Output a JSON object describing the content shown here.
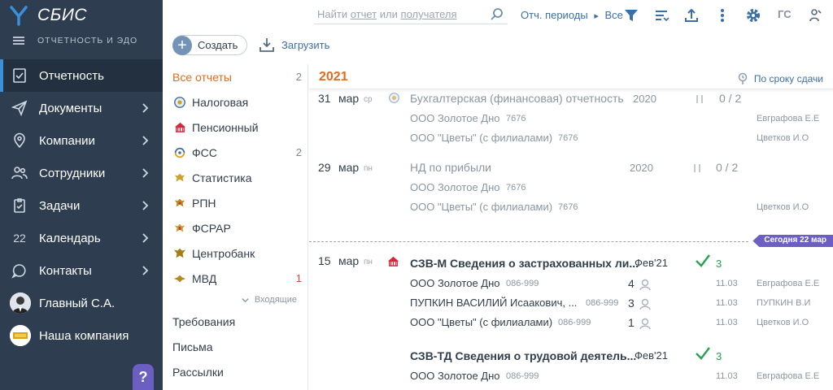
{
  "app": {
    "logo_text": "СБИС",
    "section": "ОТЧЕТНОСТЬ И ЭДО"
  },
  "sidebar": {
    "items": [
      {
        "label": "Отчетность"
      },
      {
        "label": "Документы"
      },
      {
        "label": "Компании"
      },
      {
        "label": "Сотрудники"
      },
      {
        "label": "Задачи"
      },
      {
        "label": "Календарь",
        "icon_text": "22"
      },
      {
        "label": "Контакты"
      },
      {
        "label": "Главный С.А."
      },
      {
        "label": "Наша компания"
      }
    ],
    "help": "?"
  },
  "topbar": {
    "search_placeholder": {
      "prefix": "Найти",
      "w1": "отчет",
      "mid": "или",
      "w2": "получателя"
    },
    "period": "Отч. периоды",
    "period_sep": "▸",
    "period_value": "Все",
    "initials": "ГС"
  },
  "toolbar": {
    "create": "Создать",
    "upload": "Загрузить"
  },
  "filters": {
    "all": {
      "label": "Все отчеты",
      "count": "2"
    },
    "items": [
      {
        "label": "Налоговая",
        "count": ""
      },
      {
        "label": "Пенсионный",
        "count": ""
      },
      {
        "label": "ФСС",
        "count": "2"
      },
      {
        "label": "Статистика",
        "count": ""
      },
      {
        "label": "РПН",
        "count": ""
      },
      {
        "label": "ФСРАР",
        "count": ""
      },
      {
        "label": "Центробанк",
        "count": ""
      },
      {
        "label": "МВД",
        "count": "1"
      }
    ],
    "incoming": "Входящие",
    "links": [
      "Требования",
      "Письма",
      "Рассылки"
    ]
  },
  "list": {
    "year": "2021",
    "sort": "По сроку сдачи",
    "today": "Сегодня 22 мар",
    "groups": [
      {
        "day": "31",
        "month": "мар",
        "weekday": "ср",
        "doc": "Бухгалтерская (финансовая) отчетность",
        "year": "2020",
        "progress": "0 / 2",
        "orgs": [
          {
            "name": "ООО Золотое Дно",
            "code": "7676",
            "user": "Евграфова Е.Е"
          },
          {
            "name": "ООО \"Цветы\" (с филиалами)",
            "code": "7676",
            "user": "Цветков И.О"
          }
        ]
      },
      {
        "day": "29",
        "month": "мар",
        "weekday": "пн",
        "doc": "НД по прибыли",
        "year": "2020",
        "progress": "0 / 2",
        "orgs": [
          {
            "name": "ООО Золотое Дно",
            "code": "7676",
            "user": ""
          },
          {
            "name": "ООО \"Цветы\" (с филиалами)",
            "code": "7676",
            "user": "Цветков И.О"
          }
        ]
      },
      {
        "day": "15",
        "month": "мар",
        "weekday": "пн",
        "doc": "СЗВ-М Сведения о застрахованных ли...",
        "period": "Фев'21",
        "done": "3",
        "orgs": [
          {
            "name": "ООО Золотое Дно",
            "code": "086-999",
            "n": "4",
            "date": "11.03",
            "user": "Евграфова Е.Е"
          },
          {
            "name": "ПУПКИН ВАСИЛИЙ Исаакович, ...",
            "code": "086-999",
            "n": "3",
            "date": "11.03",
            "user": "ПУПКИН В.И"
          },
          {
            "name": "ООО \"Цветы\" (с филиалами)",
            "code": "086-999",
            "n": "1",
            "date": "11.03",
            "user": "Цветков И.О"
          }
        ]
      },
      {
        "doc": "СЗВ-ТД Сведения о трудовой деятель...",
        "period": "Фев'21",
        "done": "3",
        "orgs": [
          {
            "name": "ООО Золотое Дно",
            "code": "086-999",
            "date": "11.03",
            "user": "Евграфова Е.Е"
          }
        ]
      }
    ]
  },
  "colors": {
    "sidebar_bg": "#2e3d50",
    "accent_orange": "#e36a1d",
    "link_blue": "#3c6fa5",
    "today_badge": "#6b5fc4",
    "ok_green": "#2ba052"
  }
}
